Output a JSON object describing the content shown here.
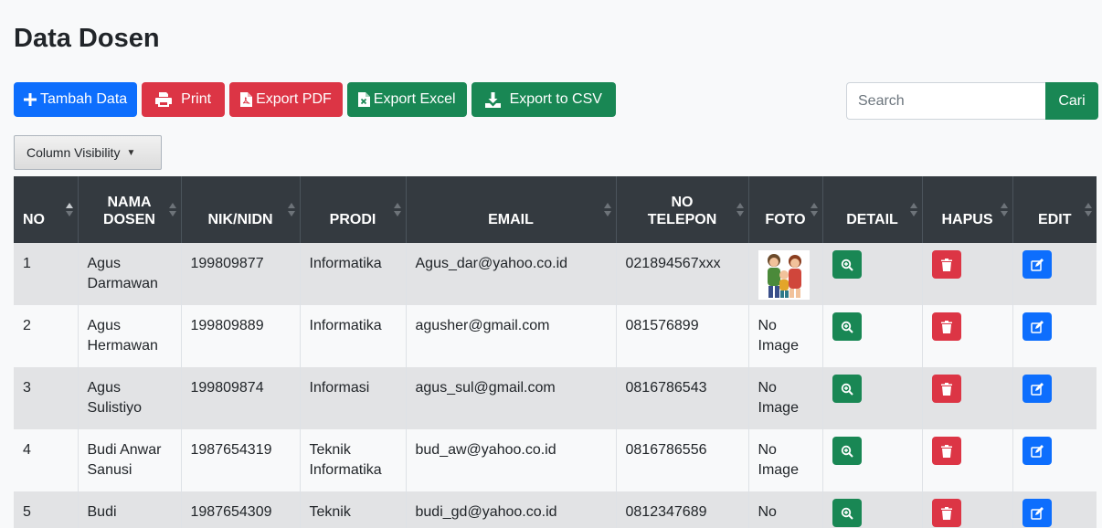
{
  "page": {
    "title": "Data Dosen"
  },
  "toolbar": {
    "tambah_label": "Tambah Data",
    "print_label": "Print",
    "pdf_label": "Export PDF",
    "excel_label": "Export Excel",
    "csv_label": "Export to CSV"
  },
  "search": {
    "placeholder": "Search",
    "button_label": "Cari"
  },
  "column_visibility": {
    "label": "Column Visibility",
    "caret": "▼"
  },
  "table": {
    "headers": {
      "no": "NO",
      "nama_line1": "NAMA",
      "nama_line2": "DOSEN",
      "nik": "NIK/NIDN",
      "prodi": "PRODI",
      "email": "EMAIL",
      "telp_line1": "NO",
      "telp_line2": "TELEPON",
      "foto": "FOTO",
      "detail": "DETAIL",
      "hapus": "HAPUS",
      "edit": "EDIT"
    },
    "rows": [
      {
        "no": "1",
        "nama_line1": "Agus",
        "nama_line2": "Darmawan",
        "nik": "199809877",
        "prodi_line1": "Informatika",
        "prodi_line2": "",
        "email": "Agus_dar@yahoo.co.id",
        "telp": "021894567xxx",
        "foto_line1": "",
        "foto_line2": ""
      },
      {
        "no": "2",
        "nama_line1": "Agus",
        "nama_line2": "Hermawan",
        "nik": "199809889",
        "prodi_line1": "Informatika",
        "prodi_line2": "",
        "email": "agusher@gmail.com",
        "telp": "081576899",
        "foto_line1": "No",
        "foto_line2": "Image"
      },
      {
        "no": "3",
        "nama_line1": "Agus",
        "nama_line2": "Sulistiyo",
        "nik": "199809874",
        "prodi_line1": "Informasi",
        "prodi_line2": "",
        "email": "agus_sul@gmail.com",
        "telp": "0816786543",
        "foto_line1": "No",
        "foto_line2": "Image"
      },
      {
        "no": "4",
        "nama_line1": "Budi Anwar",
        "nama_line2": "Sanusi",
        "nik": "1987654319",
        "prodi_line1": "Teknik",
        "prodi_line2": "Informatika",
        "email": "bud_aw@yahoo.co.id",
        "telp": "0816786556",
        "foto_line1": "No",
        "foto_line2": "Image"
      },
      {
        "no": "5",
        "nama_line1": "Budi",
        "nama_line2": "",
        "nik": "1987654309",
        "prodi_line1": "Teknik",
        "prodi_line2": "",
        "email": "budi_gd@yahoo.co.id",
        "telp": "0812347689",
        "foto_line1": "No",
        "foto_line2": ""
      }
    ]
  },
  "icons": {
    "add": "plus-icon",
    "print": "printer-icon",
    "pdf": "file-pdf-icon",
    "excel": "file-excel-icon",
    "csv": "download-icon",
    "detail": "zoom-in-icon",
    "hapus": "trash-icon",
    "edit": "edit-icon",
    "foto": "family-photo-icon"
  },
  "colors": {
    "primary": "#0d6efd",
    "danger": "#dc3545",
    "success": "#198754",
    "table_header": "#343a40",
    "row_striped": "#e2e3e5"
  }
}
